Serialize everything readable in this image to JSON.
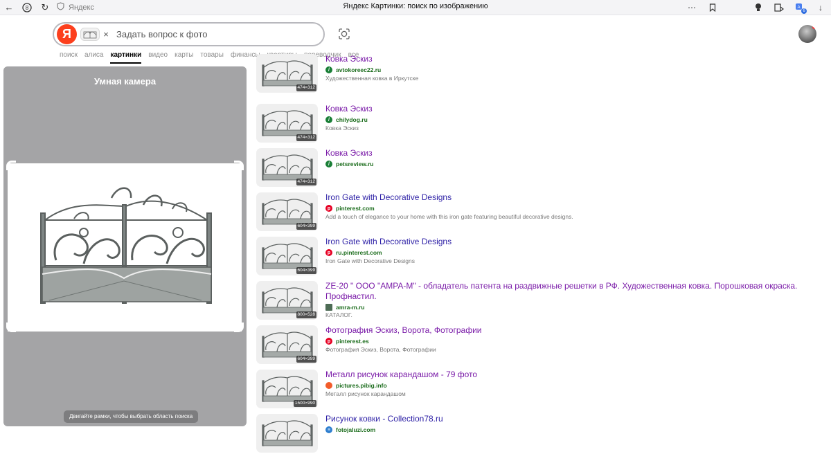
{
  "browser": {
    "site_label": "Яндекс",
    "page_title": "Яндекс Картинки: поиск по изображению",
    "ext_badge": "6"
  },
  "search": {
    "logo": "Я",
    "placeholder": "Задать вопрос к фото",
    "value": ""
  },
  "tabs": [
    {
      "label": "поиск"
    },
    {
      "label": "алиса"
    },
    {
      "label": "картинки",
      "active": true
    },
    {
      "label": "видео"
    },
    {
      "label": "карты"
    },
    {
      "label": "товары"
    },
    {
      "label": "финансы"
    },
    {
      "label": "квартиры"
    },
    {
      "label": "переводчик"
    },
    {
      "label": "все"
    }
  ],
  "camera": {
    "title": "Умная камера",
    "hint": "Двигайте рамки, чтобы выбрать область поиска"
  },
  "results": [
    {
      "title": "Ковка Эскиз",
      "domain": "avtokoreec22.ru",
      "snippet": "Художественная ковка в Иркутске",
      "dims": "474×312",
      "icon": "green-leaf-icon",
      "visited": true
    },
    {
      "title": "Ковка Эскиз",
      "domain": "chilydog.ru",
      "snippet": "Ковка Эскиз",
      "dims": "474×312",
      "icon": "green-leaf-icon",
      "visited": true
    },
    {
      "title": "Ковка Эскиз",
      "domain": "petsreview.ru",
      "snippet": "",
      "dims": "474×312",
      "icon": "green-leaf-icon",
      "visited": true
    },
    {
      "title": "Iron Gate with Decorative Designs",
      "domain": "pinterest.com",
      "snippet": "Add a touch of elegance to your home with this iron gate featuring beautiful decorative designs.",
      "dims": "604×399",
      "icon": "pinterest-icon",
      "visited": false
    },
    {
      "title": "Iron Gate with Decorative Designs",
      "domain": "ru.pinterest.com",
      "snippet": "Iron Gate with Decorative Designs",
      "dims": "604×399",
      "icon": "pinterest-icon",
      "visited": false
    },
    {
      "title": "ZE-20 \" ООО \"АМРА-М\" - обладатель патента на раздвижные решетки в РФ. Художественная ковка. Порошковая окраска. Профнастил.",
      "domain": "amra-m.ru",
      "snippet": "КАТАЛОГ.",
      "dims": "800×528",
      "icon": "amra-icon",
      "visited": true
    },
    {
      "title": "Фотография Эскиз, Ворота, Фотографии",
      "domain": "pinterest.es",
      "snippet": "Фотография Эскиз, Ворота, Фотографии",
      "dims": "604×399",
      "icon": "pinterest-icon",
      "visited": true
    },
    {
      "title": "Металл рисунок карандашом - 79 фото",
      "domain": "pictures.pibig.info",
      "snippet": "Металл рисунок карандашом",
      "dims": "1500×990",
      "icon": "cloud-icon",
      "visited": true
    },
    {
      "title": "Рисунок ковки - Collection78.ru",
      "domain": "fotojaluzi.com",
      "snippet": "",
      "dims": "",
      "icon": "blinds-icon",
      "visited": false
    }
  ],
  "colors": {
    "yandex_red": "#fc3f1d",
    "link": "#2b1ea5",
    "visited_link": "#7a1ba8",
    "domain_green": "#1c6d1d",
    "panel_gray": "#a4a4a6"
  }
}
